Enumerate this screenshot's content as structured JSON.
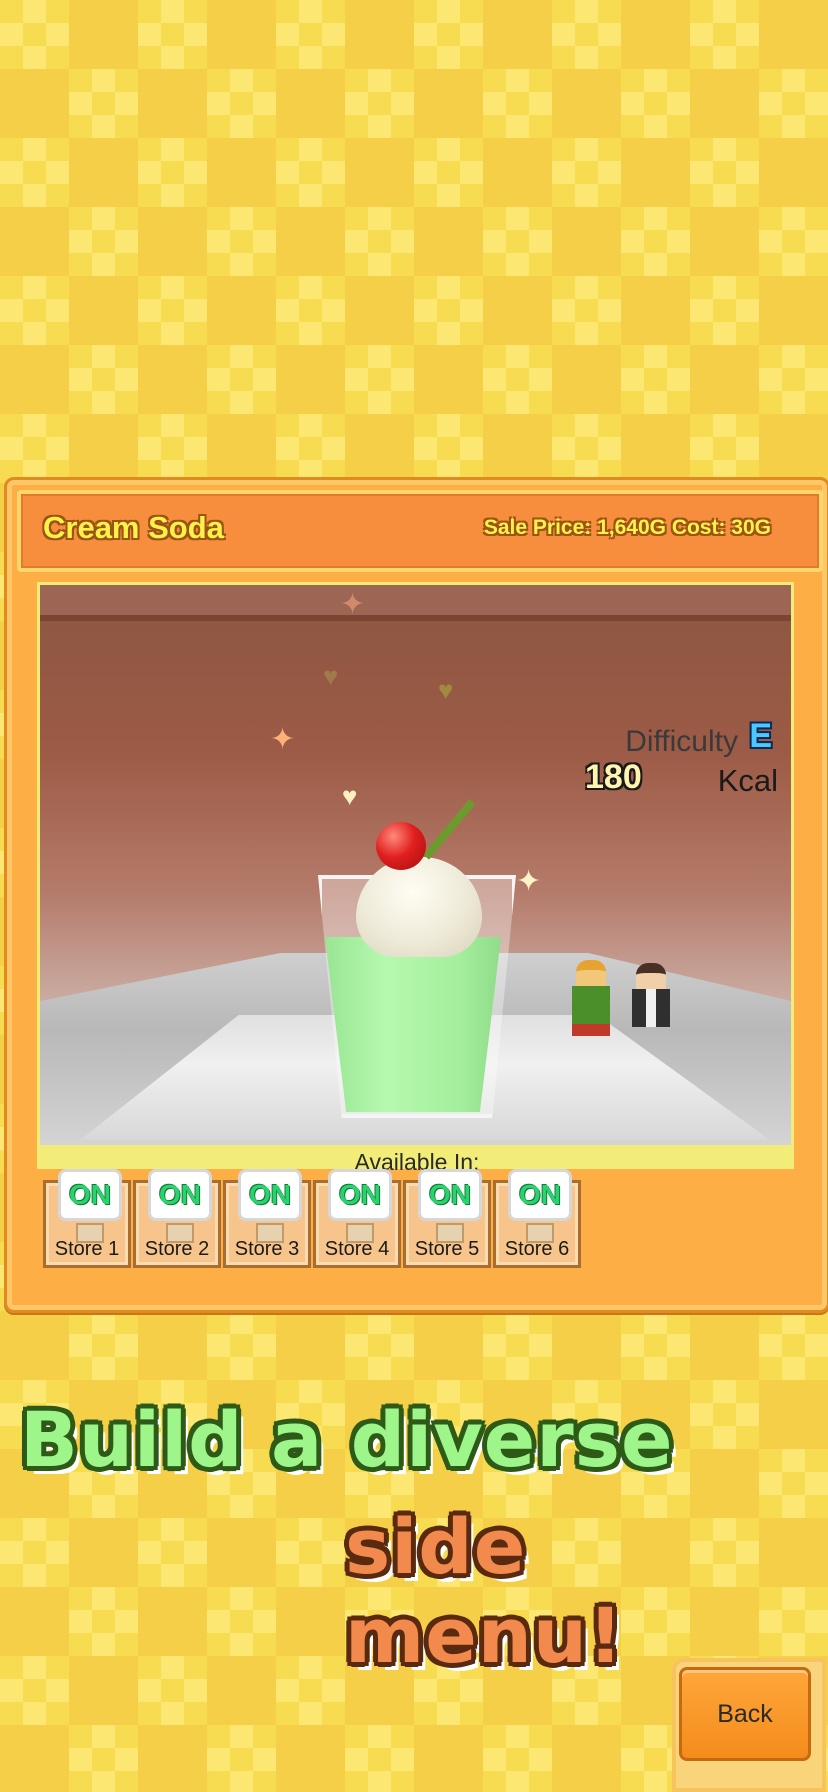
{
  "menu_item": {
    "name": "Cream Soda",
    "stats": "Sale Price: 1,640G Cost: 30G",
    "difficulty_label": "Difficulty",
    "difficulty_grade": "E",
    "kcal_value": "180",
    "kcal_unit": "Kcal"
  },
  "availability": {
    "label": "Available In:",
    "stores": [
      {
        "status": "ON",
        "label": "Store 1"
      },
      {
        "status": "ON",
        "label": "Store 2"
      },
      {
        "status": "ON",
        "label": "Store 3"
      },
      {
        "status": "ON",
        "label": "Store 4"
      },
      {
        "status": "ON",
        "label": "Store 5"
      },
      {
        "status": "ON",
        "label": "Store 6"
      }
    ]
  },
  "promo": {
    "line1": "Build a diverse",
    "line2": "side menu!"
  },
  "back_button_label": "Back",
  "icons": [
    "sparkle-icon",
    "heart-icon",
    "cherry-icon",
    "store-icon"
  ],
  "colors": {
    "panel": "#fdae45",
    "title_bar": "#f78e3d",
    "title_text": "#fff14a",
    "soda_green": "#74e86a",
    "on_green": "#2bd36c",
    "difficulty_blue": "#4bc8ff",
    "promo_green": "#9ef58a",
    "promo_orange": "#f28a4d",
    "back_button": "#f48c1c"
  }
}
